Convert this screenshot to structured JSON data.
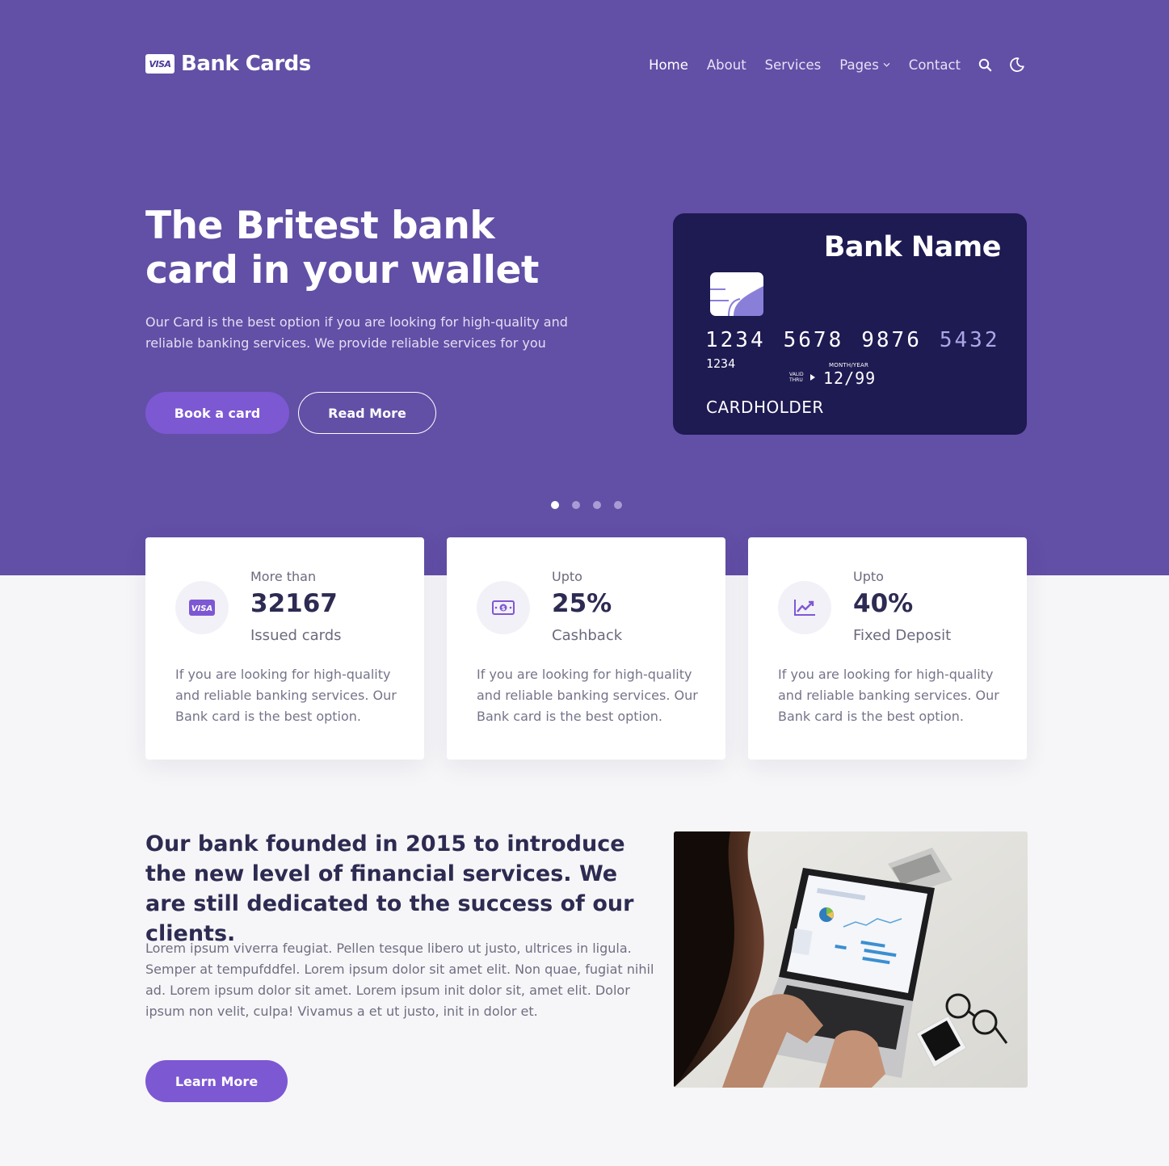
{
  "nav": {
    "badge": "VISA",
    "brand": "Bank Cards",
    "links": [
      "Home",
      "About",
      "Services",
      "Pages",
      "Contact"
    ],
    "search_icon": "search-icon",
    "theme_icon": "moon-icon"
  },
  "hero": {
    "title": "The Britest bank card in your wallet",
    "description": "Our Card is the best option if you are looking for high-quality and reliable banking services. We provide reliable services for you",
    "primary_button": "Book a card",
    "secondary_button": "Read More",
    "slides": 4,
    "active_slide": 1
  },
  "card": {
    "bank_name": "Bank Name",
    "number_groups": [
      "1234",
      "5678",
      "9876",
      "5432"
    ],
    "small_number": "1234",
    "month_year_label": "MONTH/YEAR",
    "valid_thru_label": "VALID THRU",
    "expiry": "12/99",
    "cardholder": "CARDHOLDER"
  },
  "stats": [
    {
      "pre": "More than",
      "value": "32167",
      "label": "Issued cards",
      "icon": "visa-card-icon",
      "description": "If you are looking for high-quality and reliable banking services. Our Bank card is the best option."
    },
    {
      "pre": "Upto",
      "value": "25%",
      "label": "Cashback",
      "icon": "money-bill-icon",
      "description": "If you are looking for high-quality and reliable banking services. Our Bank card is the best option."
    },
    {
      "pre": "Upto",
      "value": "40%",
      "label": "Fixed Deposit",
      "icon": "chart-line-icon",
      "description": "If you are looking for high-quality and reliable banking services. Our Bank card is the best option."
    }
  ],
  "about": {
    "title": "Our bank founded in 2015 to introduce the new level of financial services. We are still dedicated to the success of our clients.",
    "description": "Lorem ipsum viverra feugiat. Pellen tesque libero ut justo, ultrices in ligula. Semper at tempufddfel. Lorem ipsum dolor sit amet elit. Non quae, fugiat nihil ad. Lorem ipsum dolor sit amet. Lorem ipsum init dolor sit, amet elit. Dolor ipsum non velit, culpa! Vivamus a et ut justo, init in dolor et.",
    "button": "Learn More"
  },
  "colors": {
    "hero_bg": "#624fa6",
    "accent": "#7d58d3",
    "card_bg": "#1e1a52",
    "heading": "#2d2b52"
  }
}
